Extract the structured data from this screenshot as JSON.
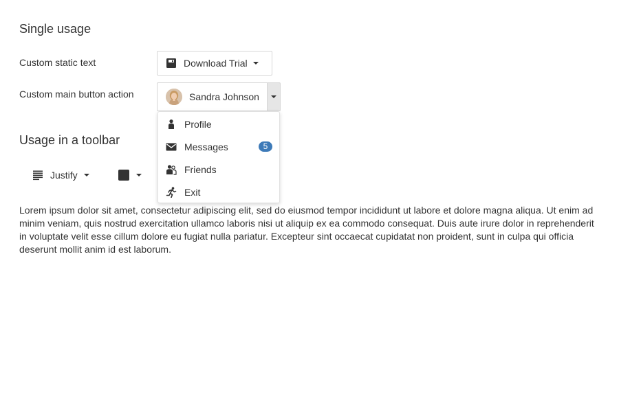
{
  "sections": {
    "single": {
      "title": "Single usage"
    },
    "toolbar": {
      "title": "Usage in a toolbar"
    }
  },
  "rows": {
    "static": {
      "label": "Custom static text",
      "button_label": "Download Trial",
      "icon": "save-icon"
    },
    "main": {
      "label": "Custom main button action",
      "button_label": "Sandra Johnson",
      "avatar": "user-avatar"
    }
  },
  "menu": {
    "items": [
      {
        "label": "Profile",
        "icon": "user-icon"
      },
      {
        "label": "Messages",
        "icon": "envelope-icon",
        "badge": "5"
      },
      {
        "label": "Friends",
        "icon": "users-icon"
      },
      {
        "label": "Exit",
        "icon": "running-icon"
      }
    ]
  },
  "toolbar": {
    "align": {
      "label": "Justify",
      "icon": "align-justify-icon"
    },
    "color": {
      "icon": "color-swatch",
      "value": "#333333"
    }
  },
  "colors": {
    "badge": "#3d7ab8",
    "split_arrow_bg": "#e6e6e6"
  },
  "content": {
    "paragraph": "Lorem ipsum dolor sit amet, consectetur adipiscing elit, sed do eiusmod tempor incididunt ut labore et dolore magna aliqua. Ut enim ad minim veniam, quis nostrud exercitation ullamco laboris nisi ut aliquip ex ea commodo consequat. Duis aute irure dolor in reprehenderit in voluptate velit esse cillum dolore eu fugiat nulla pariatur. Excepteur sint occaecat cupidatat non proident, sunt in culpa qui officia deserunt mollit anim id est laborum."
  }
}
